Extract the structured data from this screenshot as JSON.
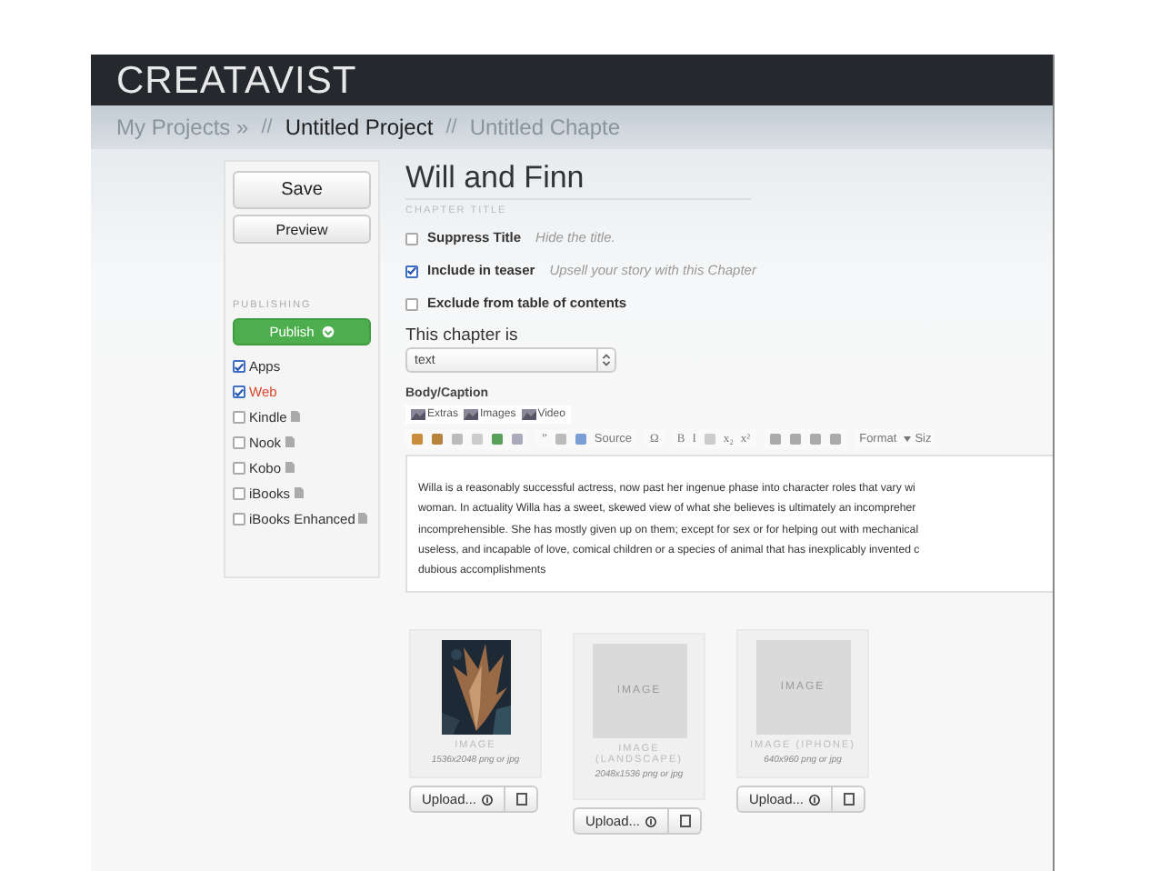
{
  "app": {
    "logo": "CREATAVIST"
  },
  "breadcrumbs": [
    {
      "label": "My Projects »",
      "current": false
    },
    {
      "separator": "//",
      "label": "Untitled Project",
      "current": true
    },
    {
      "separator": "//",
      "label": "Untitled Chapte",
      "current": false
    }
  ],
  "sidebar": {
    "save": "Save",
    "preview": "Preview",
    "section": "PUBLISHING",
    "publish": "Publish",
    "targets": [
      {
        "label": "Apps",
        "checked": true,
        "active": false,
        "doc_icon": false
      },
      {
        "label": "Web",
        "checked": true,
        "active": true,
        "doc_icon": false
      },
      {
        "label": "Kindle",
        "checked": false,
        "active": false,
        "doc_icon": true
      },
      {
        "label": "Nook",
        "checked": false,
        "active": false,
        "doc_icon": true
      },
      {
        "label": "Kobo",
        "checked": false,
        "active": false,
        "doc_icon": true
      },
      {
        "label": "iBooks",
        "checked": false,
        "active": false,
        "doc_icon": true
      },
      {
        "label": "iBooks Enhanced",
        "checked": false,
        "active": false,
        "doc_icon": true
      }
    ]
  },
  "chapter": {
    "title": "Will and Finn",
    "title_label": "CHAPTER TITLE",
    "options": [
      {
        "label": "Suppress Title",
        "hint": "Hide the title.",
        "checked": false
      },
      {
        "label": "Include in teaser",
        "hint": "Upsell your story with this Chapter",
        "checked": true
      },
      {
        "label": "Exclude from table of contents",
        "checked": false
      }
    ],
    "type_label": "This chapter is",
    "type_value": "text",
    "body_label": "Body/Caption",
    "media_tabs": [
      "Extras",
      "Images",
      "Video"
    ],
    "toolbar": [
      [
        {
          "kind": "icon"
        },
        {
          "kind": "icon"
        },
        {
          "kind": "icon"
        },
        {
          "kind": "icon"
        },
        {
          "kind": "icon"
        },
        {
          "kind": "icon"
        }
      ],
      [
        {
          "kind": "glyph",
          "label": "”"
        },
        {
          "kind": "icon"
        },
        {
          "kind": "icon"
        },
        {
          "kind": "text",
          "label": "Source"
        }
      ],
      [
        {
          "kind": "glyph",
          "label": "Ω"
        }
      ],
      [
        {
          "kind": "glyph",
          "label": "B"
        },
        {
          "kind": "glyph",
          "label": "I"
        },
        {
          "kind": "icon"
        },
        {
          "kind": "glyph",
          "label": "x₂"
        },
        {
          "kind": "glyph",
          "label": "x²"
        }
      ],
      [
        {
          "kind": "icon"
        },
        {
          "kind": "icon"
        },
        {
          "kind": "icon"
        },
        {
          "kind": "icon"
        }
      ],
      [
        {
          "kind": "text",
          "label": "Format"
        },
        {
          "kind": "dropdown",
          "label": "Siz"
        }
      ]
    ],
    "body_lines": [
      "Willa is a reasonably successful actress, now past her ingenue phase into character roles that vary wi",
      "woman. In actuality Willa has a sweet, skewed view of what she believes is ultimately an incompreher",
      "incomprehensible. She has mostly given up on them; except for sex or for helping out with mechanical",
      "useless, and incapable of love, comical children or a species of animal that has inexplicably invented c",
      "dubious accomplishments"
    ]
  },
  "images": [
    {
      "kind": "picture",
      "caption": "IMAGE",
      "size": "1536x2048 png or jpg",
      "upload": "Upload..."
    },
    {
      "kind": "empty",
      "placeholder": "IMAGE",
      "caption": "IMAGE (LANDSCAPE)",
      "size": "2048x1536 png or jpg",
      "upload": "Upload..."
    },
    {
      "kind": "empty",
      "placeholder": "IMAGE",
      "caption": "IMAGE (IPHONE)",
      "size": "640x960 png or jpg",
      "upload": "Upload..."
    }
  ]
}
